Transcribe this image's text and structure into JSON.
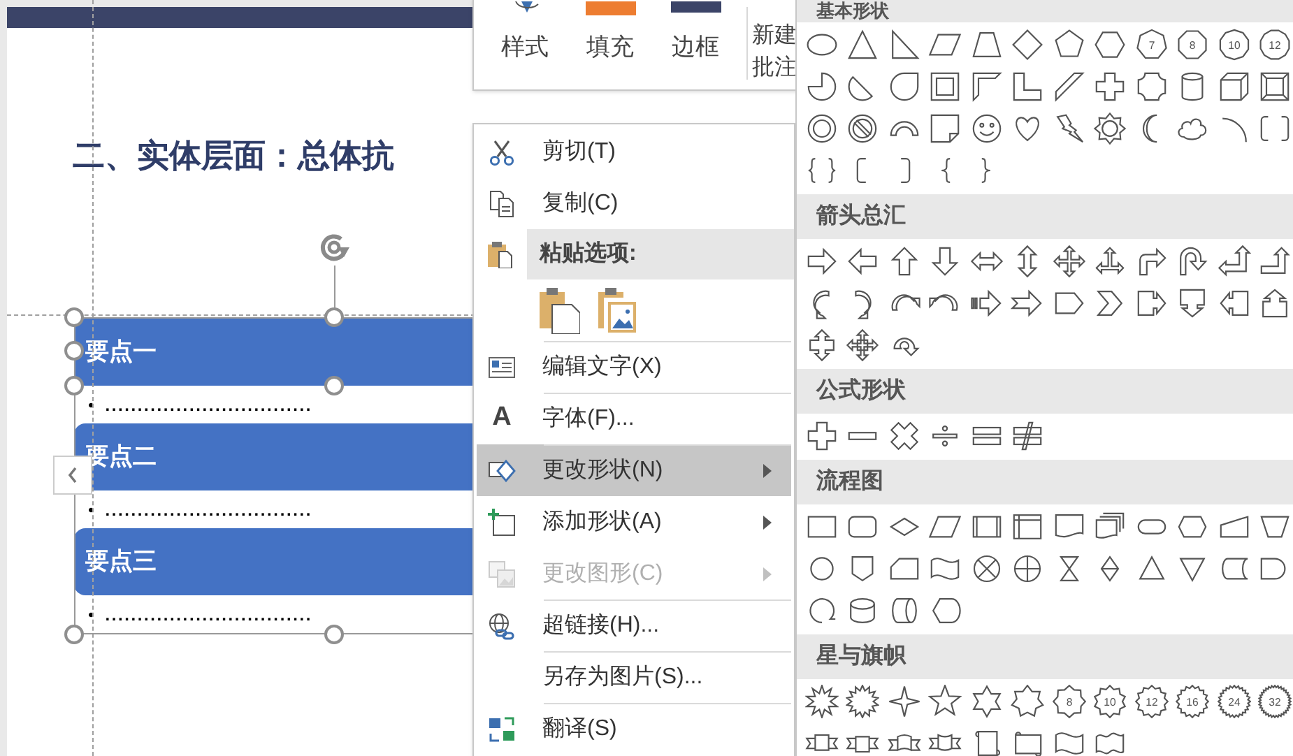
{
  "mini_toolbar": {
    "buttons": [
      {
        "label": "样式"
      },
      {
        "label": "填充"
      },
      {
        "label": "边框"
      },
      {
        "label": "新建批注"
      }
    ]
  },
  "slide": {
    "title": "二、实体层面：总体抗",
    "points": [
      {
        "heading": "要点一",
        "bullet": "•",
        "text": "................................"
      },
      {
        "heading": "要点二",
        "bullet": "•",
        "text": "................................"
      },
      {
        "heading": "要点三",
        "bullet": "•",
        "text": "................................"
      }
    ]
  },
  "context_menu": {
    "items": [
      {
        "kind": "item",
        "label": "剪切(T)",
        "selected": false,
        "disabled": false,
        "submenu": false,
        "divider_above": false
      },
      {
        "kind": "item",
        "label": "复制(C)",
        "selected": false,
        "disabled": false,
        "submenu": false,
        "divider_above": false
      },
      {
        "kind": "header",
        "label": "粘贴选项:"
      },
      {
        "kind": "paste_options"
      },
      {
        "kind": "item",
        "label": "编辑文字(X)",
        "selected": false,
        "disabled": false,
        "submenu": false,
        "divider_above": true
      },
      {
        "kind": "item",
        "label": "字体(F)...",
        "icon_glyph": "A",
        "selected": false,
        "disabled": false,
        "submenu": false,
        "divider_above": true
      },
      {
        "kind": "item",
        "label": "更改形状(N)",
        "selected": true,
        "disabled": false,
        "submenu": true,
        "divider_above": true
      },
      {
        "kind": "item",
        "label": "添加形状(A)",
        "selected": false,
        "disabled": false,
        "submenu": true,
        "divider_above": false
      },
      {
        "kind": "item",
        "label": "更改图形(C)",
        "selected": false,
        "disabled": true,
        "submenu": true,
        "divider_above": false
      },
      {
        "kind": "item",
        "label": "超链接(H)...",
        "selected": false,
        "disabled": false,
        "submenu": false,
        "divider_above": true
      },
      {
        "kind": "item",
        "label": "另存为图片(S)...",
        "selected": false,
        "disabled": false,
        "submenu": false,
        "divider_above": true
      },
      {
        "kind": "item",
        "label": "翻译(S)",
        "selected": false,
        "disabled": false,
        "submenu": false,
        "divider_above": true
      }
    ]
  },
  "shape_gallery": {
    "sections": [
      {
        "title": "基本形状",
        "badges": [
          "7",
          "8",
          "10",
          "12"
        ]
      },
      {
        "title": "箭头总汇"
      },
      {
        "title": "公式形状"
      },
      {
        "title": "流程图"
      },
      {
        "title": "星与旗帜",
        "badges": [
          "8",
          "10",
          "12",
          "16",
          "24",
          "32"
        ]
      }
    ]
  }
}
